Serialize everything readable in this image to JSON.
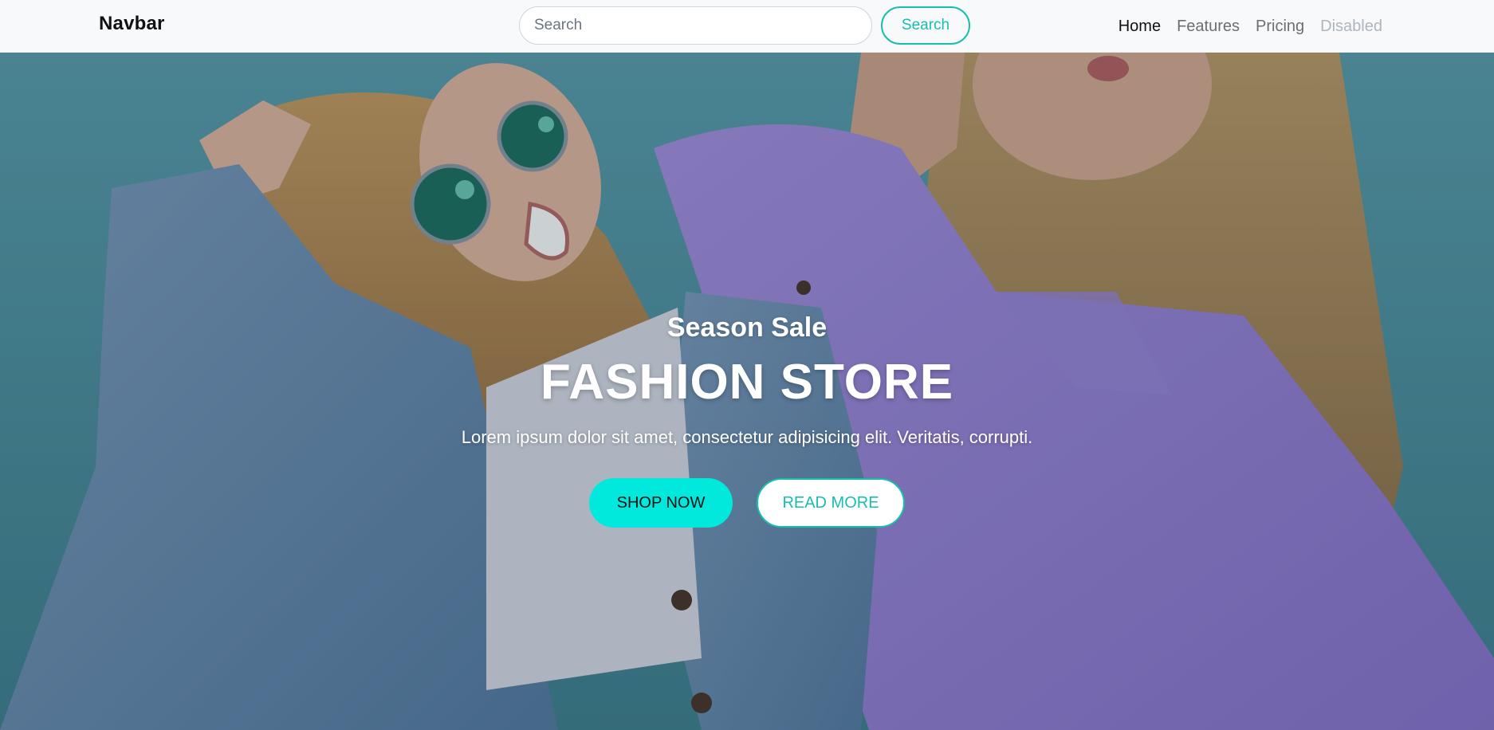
{
  "navbar": {
    "brand": "Navbar",
    "search": {
      "placeholder": "Search",
      "value": "",
      "button_label": "Search"
    },
    "links": [
      {
        "label": "Home",
        "state": "active"
      },
      {
        "label": "Features",
        "state": "normal"
      },
      {
        "label": "Pricing",
        "state": "normal"
      },
      {
        "label": "Disabled",
        "state": "disabled"
      }
    ]
  },
  "hero": {
    "subtitle": "Season Sale",
    "title": "FASHION STORE",
    "text": "Lorem ipsum dolor sit amet, consectetur adipisicing elit. Veritatis, corrupti.",
    "primary_button": "SHOP NOW",
    "secondary_button": "READ MORE",
    "image": "hero-photo-two-women-denim-jacket-purple-hoodie"
  },
  "colors": {
    "accent": "#17bfae",
    "primary_button": "#00e9dc",
    "navbar_bg": "#f8f9fa",
    "hero_bg": "#4d8f9d"
  }
}
